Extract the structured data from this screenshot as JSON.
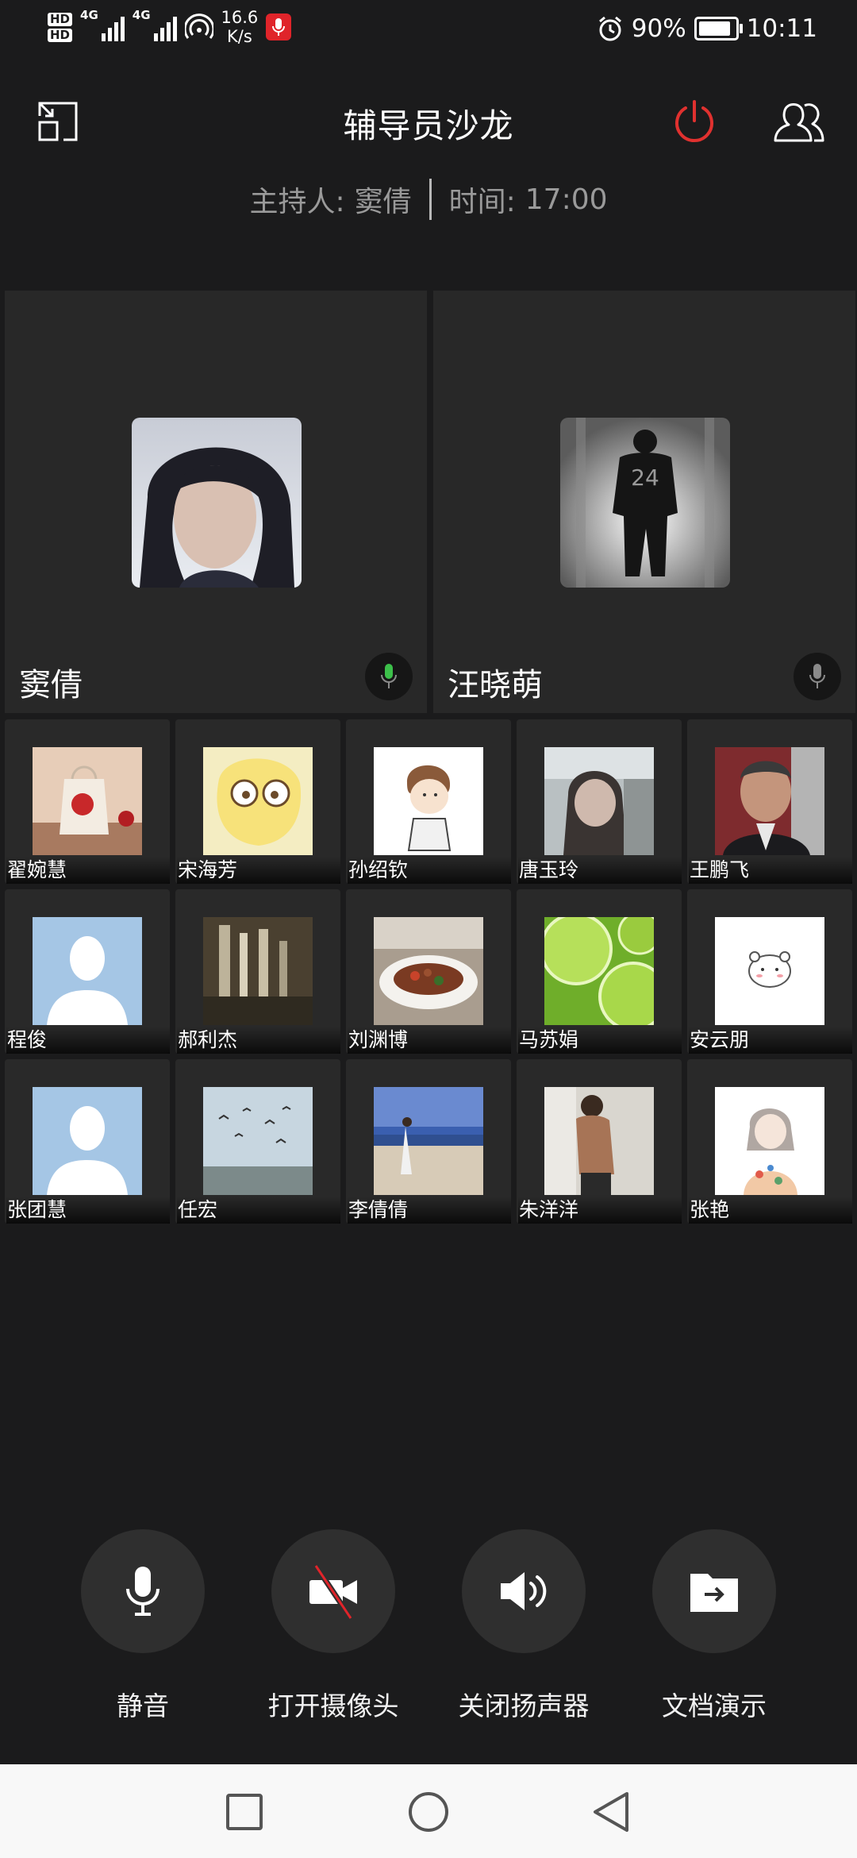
{
  "status_bar": {
    "hd1": "HD",
    "hd2": "HD",
    "net1": "4G",
    "net2": "4G",
    "speed_value": "16.6",
    "speed_unit": "K/s",
    "battery_percent": "90%",
    "battery_level": 0.9,
    "time": "10:11"
  },
  "header": {
    "title": "辅导员沙龙",
    "host_label": "主持人:",
    "host_name": "窦倩",
    "time_label": "时间:",
    "time_value": "17:00"
  },
  "main_speakers": [
    {
      "name": "窦倩",
      "mic_active": true
    },
    {
      "name": "汪晓萌",
      "mic_active": false
    }
  ],
  "participants": [
    {
      "name": "翟婉慧"
    },
    {
      "name": "宋海芳"
    },
    {
      "name": "孙绍钦"
    },
    {
      "name": "唐玉玲"
    },
    {
      "name": "王鹏飞"
    },
    {
      "name": "程俊"
    },
    {
      "name": "郝利杰"
    },
    {
      "name": "刘渊博"
    },
    {
      "name": "马苏娟"
    },
    {
      "name": "安云朋"
    },
    {
      "name": "张团慧"
    },
    {
      "name": "任宏"
    },
    {
      "name": "李倩倩"
    },
    {
      "name": "朱洋洋"
    },
    {
      "name": "张艳"
    }
  ],
  "controls": {
    "mute_label": "静音",
    "camera_label": "打开摄像头",
    "speaker_label": "关闭扬声器",
    "doc_label": "文档演示"
  },
  "colors": {
    "background": "#1b1b1c",
    "tile": "#282828",
    "power_red": "#e0312f",
    "mic_active_green": "#3cc04a",
    "camera_off_red": "#e0242a"
  }
}
